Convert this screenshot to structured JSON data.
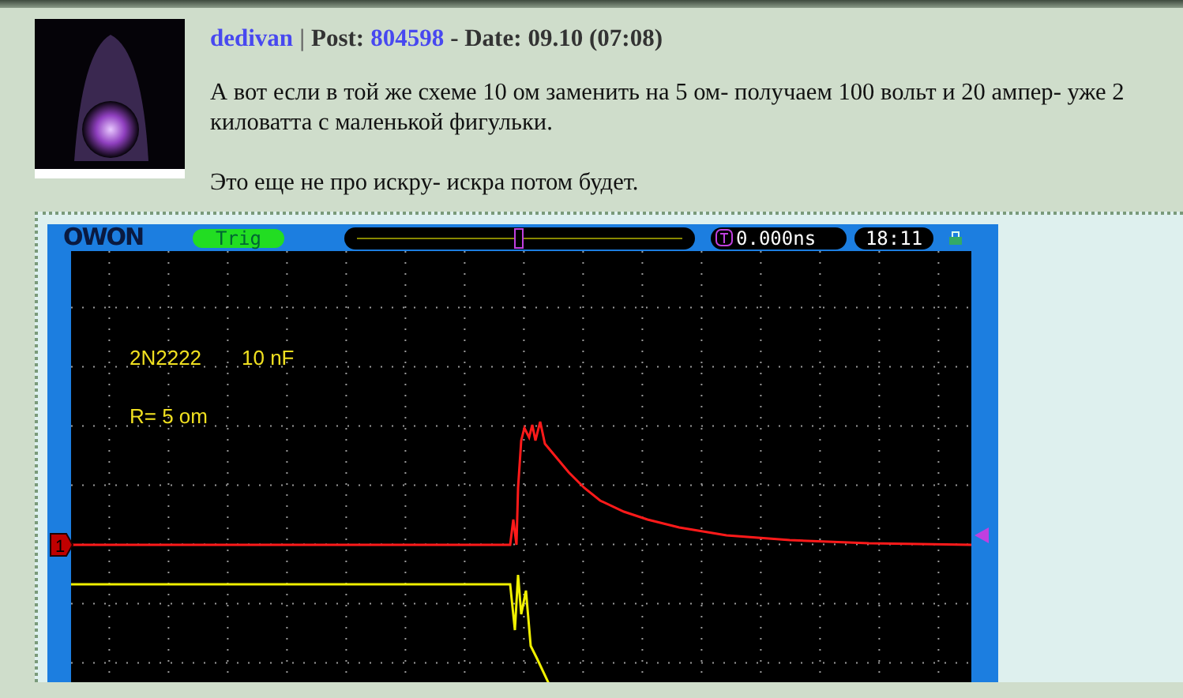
{
  "post": {
    "author": "dedivan",
    "separator": "|",
    "post_label": "Post:",
    "post_number": "804598",
    "date_label": "- Date:",
    "date": "09.10 (07:08)",
    "paragraphs": [
      "А вот если в той же схеме 10 ом заменить на 5 ом- получаем 100 вольт и 20 ампер- уже 2 киловатта с маленькой фигульки.",
      "Это еще не про искру- искра потом будет."
    ]
  },
  "scope": {
    "logo": "OWON",
    "trigger_status": "Trig",
    "time_offset": "0.000ns",
    "clock": "18:11",
    "channel_marker": "1",
    "annotation_lines": [
      {
        "parts": [
          "2N2222",
          "10 nF"
        ]
      },
      {
        "parts": [
          "R= 5 om"
        ]
      }
    ]
  }
}
